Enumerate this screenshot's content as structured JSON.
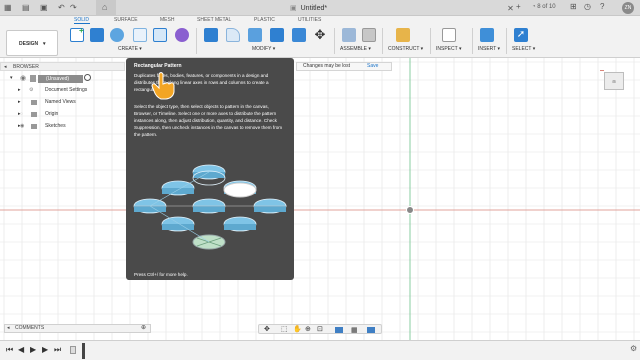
{
  "titlebar": {
    "document_title": "Untitled*",
    "page_counter": "8 of 10",
    "user_initials": "ZN"
  },
  "tabs": [
    "SOLID",
    "SURFACE",
    "MESH",
    "SHEET METAL",
    "PLASTIC",
    "UTILITIES"
  ],
  "workspace": {
    "label": "DESIGN"
  },
  "toolbar_groups": {
    "create": "CREATE",
    "modify": "MODIFY",
    "assemble": "ASSEMBLE",
    "construct": "CONSTRUCT",
    "inspect": "INSPECT",
    "insert": "INSERT",
    "select": "SELECT"
  },
  "browser": {
    "header": "BROWSER",
    "root": "(Unsaved)",
    "items": [
      "Document Settings",
      "Named Views",
      "Origin",
      "Sketches"
    ]
  },
  "changes_bar": {
    "message": "Changes may be lost",
    "save_label": "Save"
  },
  "tooltip": {
    "title": "Rectangular Pattern",
    "paragraph1": "Duplicates faces, bodies, features, or components in a design and distributes them along linear axes in rows and columns to create a rectangular pattern.",
    "paragraph2": "Select the object type, then select objects to pattern in the canvas, Browser, or Timeline. Select one or more axes to distribute the pattern instances along, then adjust distribution, quantity, and distance. Check Suppression, then uncheck instances in the canvas to remove them from the pattern.",
    "footer": "Press Ctrl+/ for more help."
  },
  "comments": {
    "label": "COMMENTS"
  },
  "colors": {
    "accent": "#1a73c8",
    "tooltip_bg": "#4a4a4a",
    "disc_blue": "#7fc4e6",
    "axis_red": "#d9857a",
    "axis_green": "#6cc08b"
  }
}
